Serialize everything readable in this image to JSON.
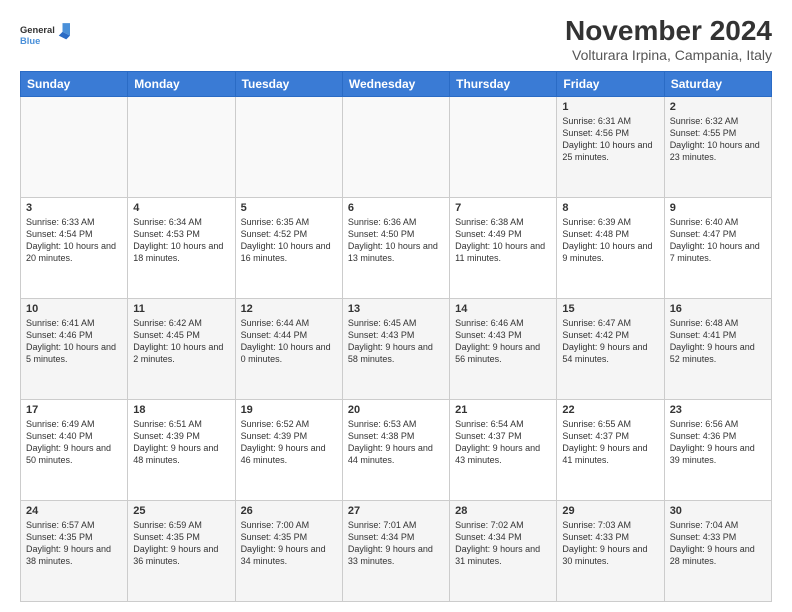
{
  "header": {
    "logo_line1": "General",
    "logo_line2": "Blue",
    "main_title": "November 2024",
    "subtitle": "Volturara Irpina, Campania, Italy"
  },
  "days_of_week": [
    "Sunday",
    "Monday",
    "Tuesday",
    "Wednesday",
    "Thursday",
    "Friday",
    "Saturday"
  ],
  "weeks": [
    [
      {
        "day": "",
        "info": "",
        "empty": true
      },
      {
        "day": "",
        "info": "",
        "empty": true
      },
      {
        "day": "",
        "info": "",
        "empty": true
      },
      {
        "day": "",
        "info": "",
        "empty": true
      },
      {
        "day": "",
        "info": "",
        "empty": true
      },
      {
        "day": "1",
        "info": "Sunrise: 6:31 AM\nSunset: 4:56 PM\nDaylight: 10 hours and 25 minutes."
      },
      {
        "day": "2",
        "info": "Sunrise: 6:32 AM\nSunset: 4:55 PM\nDaylight: 10 hours and 23 minutes."
      }
    ],
    [
      {
        "day": "3",
        "info": "Sunrise: 6:33 AM\nSunset: 4:54 PM\nDaylight: 10 hours and 20 minutes."
      },
      {
        "day": "4",
        "info": "Sunrise: 6:34 AM\nSunset: 4:53 PM\nDaylight: 10 hours and 18 minutes."
      },
      {
        "day": "5",
        "info": "Sunrise: 6:35 AM\nSunset: 4:52 PM\nDaylight: 10 hours and 16 minutes."
      },
      {
        "day": "6",
        "info": "Sunrise: 6:36 AM\nSunset: 4:50 PM\nDaylight: 10 hours and 13 minutes."
      },
      {
        "day": "7",
        "info": "Sunrise: 6:38 AM\nSunset: 4:49 PM\nDaylight: 10 hours and 11 minutes."
      },
      {
        "day": "8",
        "info": "Sunrise: 6:39 AM\nSunset: 4:48 PM\nDaylight: 10 hours and 9 minutes."
      },
      {
        "day": "9",
        "info": "Sunrise: 6:40 AM\nSunset: 4:47 PM\nDaylight: 10 hours and 7 minutes."
      }
    ],
    [
      {
        "day": "10",
        "info": "Sunrise: 6:41 AM\nSunset: 4:46 PM\nDaylight: 10 hours and 5 minutes."
      },
      {
        "day": "11",
        "info": "Sunrise: 6:42 AM\nSunset: 4:45 PM\nDaylight: 10 hours and 2 minutes."
      },
      {
        "day": "12",
        "info": "Sunrise: 6:44 AM\nSunset: 4:44 PM\nDaylight: 10 hours and 0 minutes."
      },
      {
        "day": "13",
        "info": "Sunrise: 6:45 AM\nSunset: 4:43 PM\nDaylight: 9 hours and 58 minutes."
      },
      {
        "day": "14",
        "info": "Sunrise: 6:46 AM\nSunset: 4:43 PM\nDaylight: 9 hours and 56 minutes."
      },
      {
        "day": "15",
        "info": "Sunrise: 6:47 AM\nSunset: 4:42 PM\nDaylight: 9 hours and 54 minutes."
      },
      {
        "day": "16",
        "info": "Sunrise: 6:48 AM\nSunset: 4:41 PM\nDaylight: 9 hours and 52 minutes."
      }
    ],
    [
      {
        "day": "17",
        "info": "Sunrise: 6:49 AM\nSunset: 4:40 PM\nDaylight: 9 hours and 50 minutes."
      },
      {
        "day": "18",
        "info": "Sunrise: 6:51 AM\nSunset: 4:39 PM\nDaylight: 9 hours and 48 minutes."
      },
      {
        "day": "19",
        "info": "Sunrise: 6:52 AM\nSunset: 4:39 PM\nDaylight: 9 hours and 46 minutes."
      },
      {
        "day": "20",
        "info": "Sunrise: 6:53 AM\nSunset: 4:38 PM\nDaylight: 9 hours and 44 minutes."
      },
      {
        "day": "21",
        "info": "Sunrise: 6:54 AM\nSunset: 4:37 PM\nDaylight: 9 hours and 43 minutes."
      },
      {
        "day": "22",
        "info": "Sunrise: 6:55 AM\nSunset: 4:37 PM\nDaylight: 9 hours and 41 minutes."
      },
      {
        "day": "23",
        "info": "Sunrise: 6:56 AM\nSunset: 4:36 PM\nDaylight: 9 hours and 39 minutes."
      }
    ],
    [
      {
        "day": "24",
        "info": "Sunrise: 6:57 AM\nSunset: 4:35 PM\nDaylight: 9 hours and 38 minutes."
      },
      {
        "day": "25",
        "info": "Sunrise: 6:59 AM\nSunset: 4:35 PM\nDaylight: 9 hours and 36 minutes."
      },
      {
        "day": "26",
        "info": "Sunrise: 7:00 AM\nSunset: 4:35 PM\nDaylight: 9 hours and 34 minutes."
      },
      {
        "day": "27",
        "info": "Sunrise: 7:01 AM\nSunset: 4:34 PM\nDaylight: 9 hours and 33 minutes."
      },
      {
        "day": "28",
        "info": "Sunrise: 7:02 AM\nSunset: 4:34 PM\nDaylight: 9 hours and 31 minutes."
      },
      {
        "day": "29",
        "info": "Sunrise: 7:03 AM\nSunset: 4:33 PM\nDaylight: 9 hours and 30 minutes."
      },
      {
        "day": "30",
        "info": "Sunrise: 7:04 AM\nSunset: 4:33 PM\nDaylight: 9 hours and 28 minutes."
      }
    ]
  ]
}
